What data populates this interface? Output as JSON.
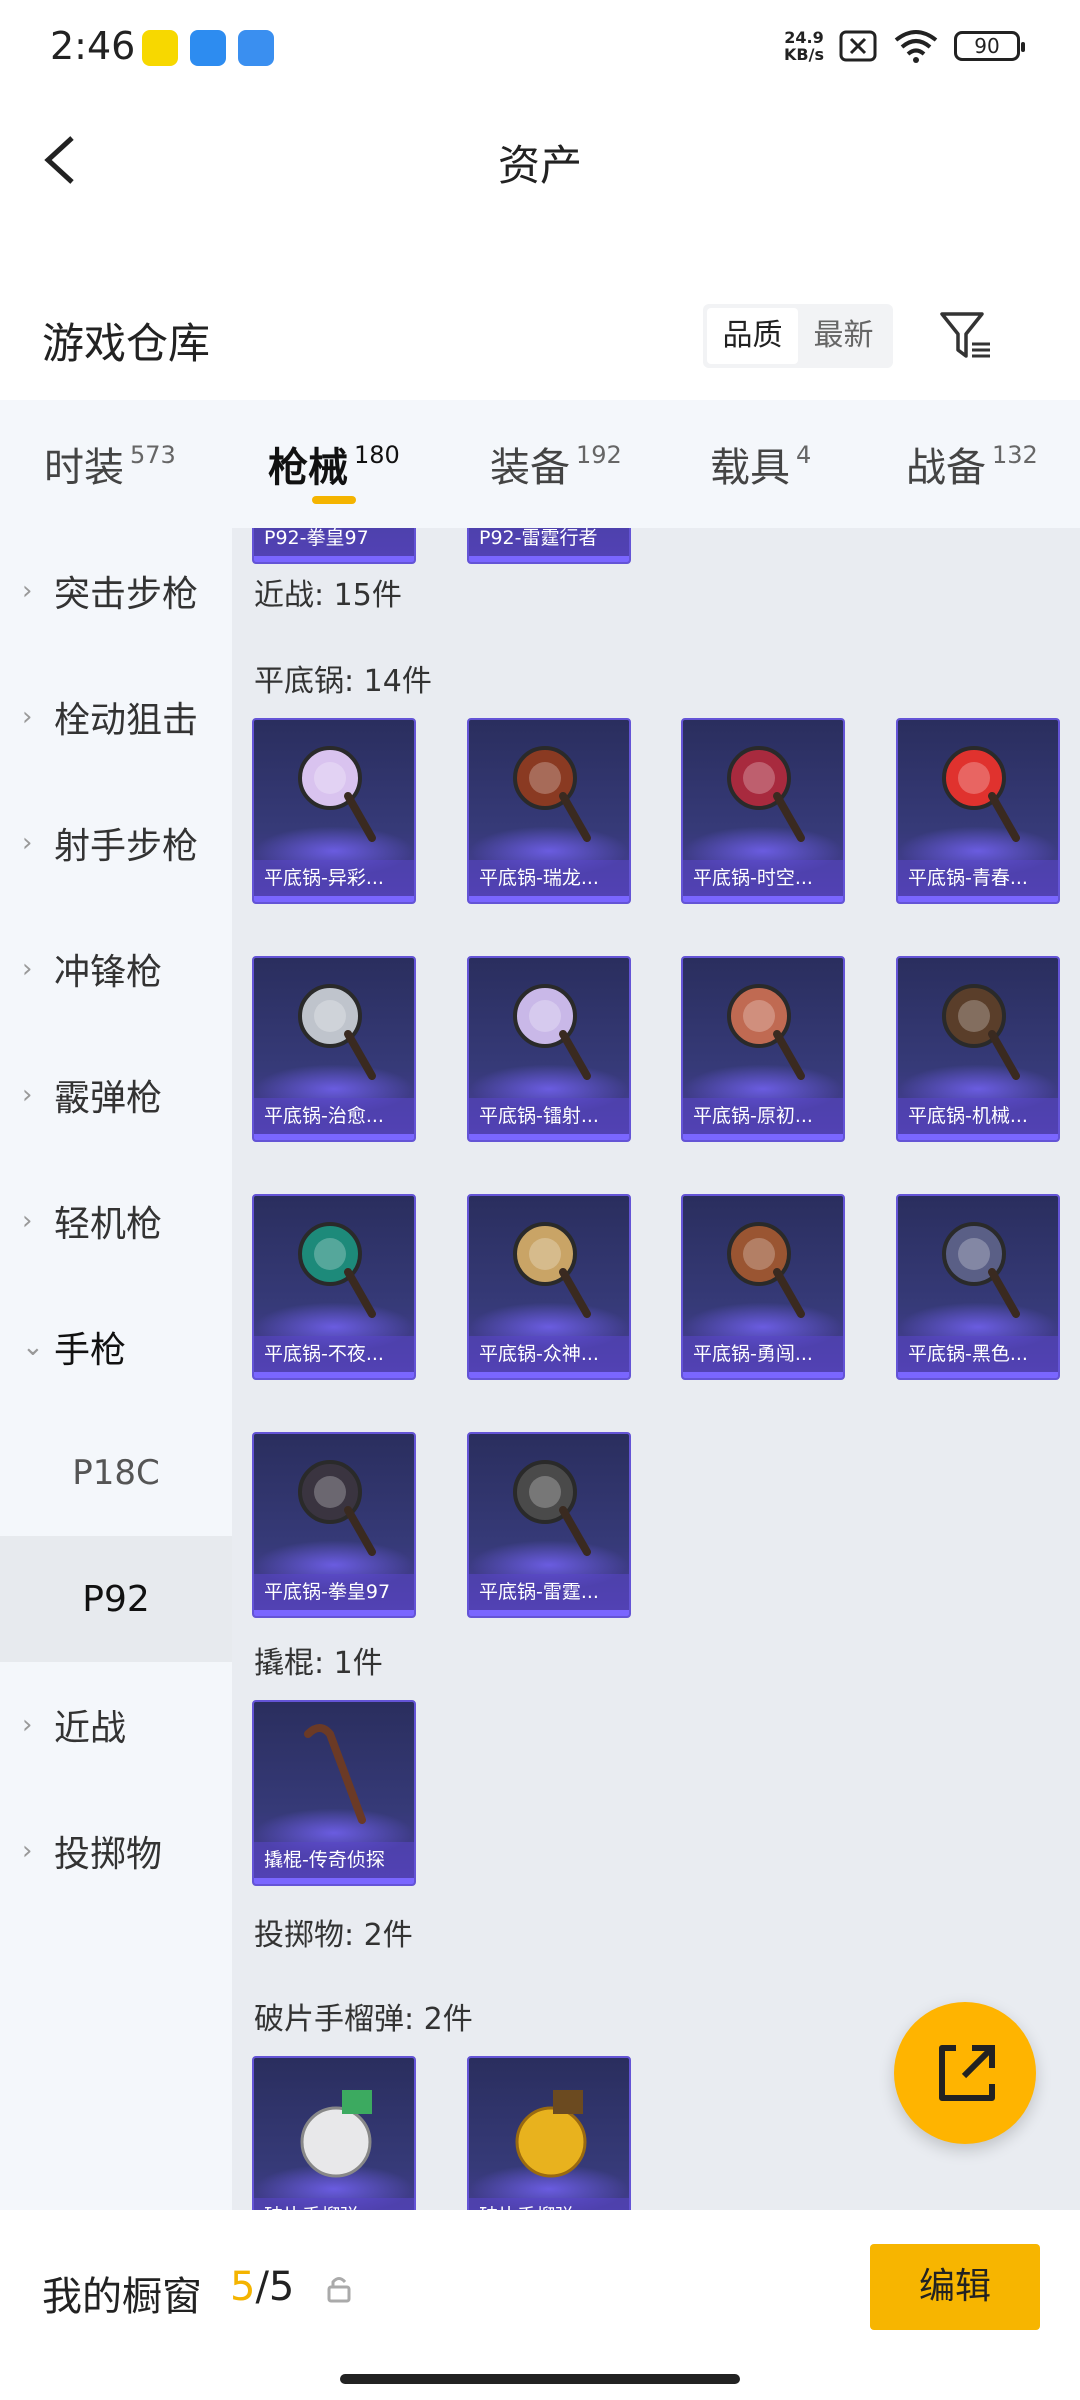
{
  "status_bar": {
    "time": "2:46",
    "net_speed_value": "24.9",
    "net_speed_unit": "KB/s",
    "battery": "90"
  },
  "header": {
    "title": "资产"
  },
  "warehouse": {
    "title": "游戏仓库",
    "sort_options": [
      "品质",
      "最新"
    ],
    "sort_active": "品质"
  },
  "tabs": [
    {
      "label": "时装",
      "count": "573"
    },
    {
      "label": "枪械",
      "count": "180",
      "active": true
    },
    {
      "label": "装备",
      "count": "192"
    },
    {
      "label": "载具",
      "count": "4"
    },
    {
      "label": "战备",
      "count": "132"
    }
  ],
  "sidebar": {
    "items": [
      "突击步枪",
      "栓动狙击",
      "射手步枪",
      "冲锋枪",
      "霰弹枪",
      "轻机枪",
      "手枪"
    ],
    "sub_items": [
      "P18C",
      "P92"
    ],
    "active_sub": "P92",
    "after_items": [
      "近战",
      "投掷物"
    ]
  },
  "content": {
    "partial_cards": [
      "P92-拳皇97",
      "P92-雷霆行者"
    ],
    "sections": {
      "melee": "近战: 15件",
      "pan": "平底锅: 14件",
      "crowbar": "撬棍: 1件",
      "throwable": "投掷物: 2件",
      "frag": "破片手榴弹: 2件"
    },
    "pan_items": [
      "平底锅-异彩...",
      "平底锅-瑞龙...",
      "平底锅-时空...",
      "平底锅-青春...",
      "平底锅-治愈...",
      "平底锅-镭射...",
      "平底锅-原初...",
      "平底锅-机械...",
      "平底锅-不夜...",
      "平底锅-众神...",
      "平底锅-勇闯...",
      "平底锅-黑色...",
      "平底锅-拳皇97",
      "平底锅-雷霆..."
    ],
    "crowbar_items": [
      "撬棍-传奇侦探"
    ],
    "frag_items": [
      "破片手榴弹",
      "破片手榴弹"
    ]
  },
  "showcase": {
    "label": "我的橱窗",
    "used": "5",
    "total": "/5",
    "edit_label": "编辑"
  },
  "colors": {
    "accent": "#f4b400",
    "card_bg": "#363a78",
    "card_border": "#6454d6"
  }
}
